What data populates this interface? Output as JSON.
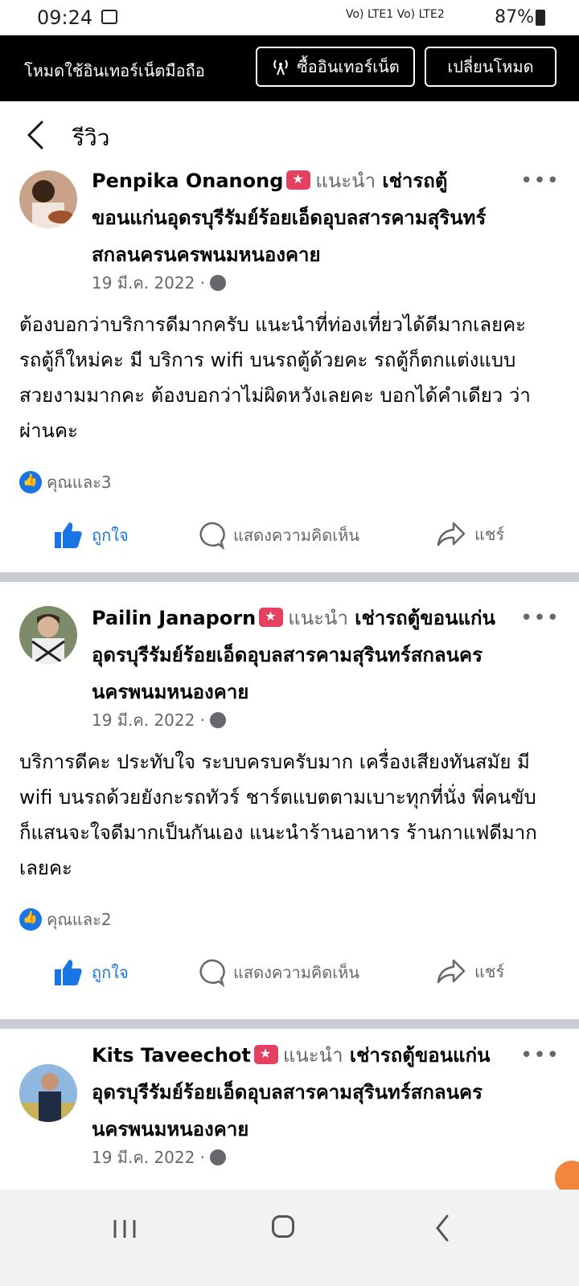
{
  "status_bar": {
    "time": "09:24",
    "network_labels": "Vo) LTE1  Vo) LTE2",
    "battery": "87%"
  },
  "data_bar": {
    "mode_text": "โหมดใช้อินเทอร์เน็ตมือถือ",
    "buy_button": "ซื้ออินเทอร์เน็ต",
    "switch_button": "เปลี่ยนโหมด"
  },
  "header": {
    "title": "รีวิว"
  },
  "posts": [
    {
      "name": "Penpika Onanong",
      "recommends": "แนะนำ",
      "page": "เช่ารถตู้ขอนแก่นอุดรบุรีรัมย์ร้อยเอ็ดอุบลสารคามสุรินทร์สกลนครนครพนมหนองคาย",
      "date": "19 มี.ค. 2022 ·",
      "text": "ต้องบอกว่าบริการดีมากครับ แนะนำที่ท่องเที่ยวได้ดีมากเลยคะ รถตู้ก็ใหม่คะ มี บริการ wifi บนรถตู้ด้วยคะ รถตู้ก็ตกแต่งแบบสวยงามมากคะ ต้องบอกว่าไม่ผิดหวังเลยคะ บอกได้คำเดียว ว่า ผ่านคะ",
      "reactions": "คุณและ3"
    },
    {
      "name": "Pailin Janaporn",
      "recommends": "แนะนำ",
      "page": "เช่ารถตู้ขอนแก่นอุดรบุรีรัมย์ร้อยเอ็ดอุบลสารคามสุรินทร์สกลนครนครพนมหนองคาย",
      "date": "19 มี.ค. 2022 ·",
      "text": "บริการดีคะ ประทับใจ ระบบครบครับมาก เครื่องเสียงทันสมัย มี wifi บนรถด้วยยังกะรถทัวร์ ชาร์ตแบตตามเบาะทุกที่นั่ง พี่คนขับก็แสนจะใจดีมากเป็นกันเอง แนะนำร้านอาหาร ร้านกาแฟดีมากเลยคะ",
      "reactions": "คุณและ2"
    },
    {
      "name": "Kits Taveechot",
      "recommends": "แนะนำ",
      "page": "เช่ารถตู้ขอนแก่นอุดรบุรีรัมย์ร้อยเอ็ดอุบลสารคามสุรินทร์สกลนครนครพนมหนองคาย",
      "date": "19 มี.ค. 2022 ·"
    }
  ],
  "actions": {
    "like": "ถูกใจ",
    "comment": "แสดงความคิดเห็น",
    "share": "แชร์"
  },
  "more_glyph": "•••",
  "colors": {
    "blue": "#1b74e4",
    "grey_text": "#65676b",
    "badge": "#e4405f",
    "divider": "#c9ccd1"
  }
}
